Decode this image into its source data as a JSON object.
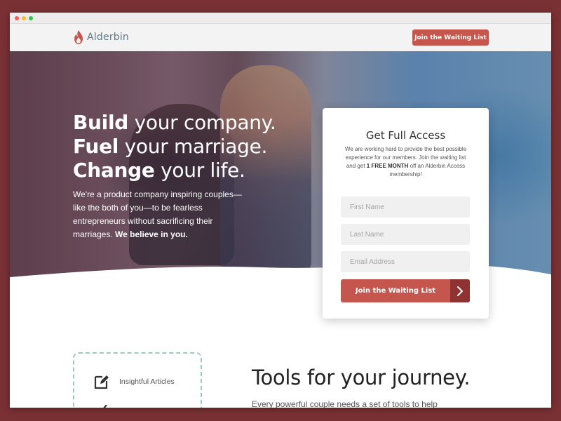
{
  "colors": {
    "brand": "#c4564d",
    "brand_dark": "#8e3331",
    "logo_text": "#5d7a84",
    "dash_border": "#9fc9bf",
    "backdrop": "#7a3134"
  },
  "nav": {
    "logo_text": "Alderbin",
    "cta_label": "Join the Waiting List"
  },
  "hero": {
    "lines": [
      {
        "bold": "Build",
        "rest": " your company."
      },
      {
        "bold": "Fuel",
        "rest": " your marriage."
      },
      {
        "bold": "Change",
        "rest": " your life."
      }
    ],
    "subtext": "We're a product company inspiring couples—like the both of you—to be fearless entrepreneurs without sacrificing their marriages.",
    "subtext_bold": "We believe in you."
  },
  "signup": {
    "title": "Get Full Access",
    "desc_before": "We are working hard to provide the best possible experience for our members. Join the waiting list and get ",
    "desc_bold": "1 FREE MONTH",
    "desc_after": " off an Alderbin Access membership!",
    "first_name_placeholder": "First Name",
    "last_name_placeholder": "Last Name",
    "email_placeholder": "Email Address",
    "cta_label": "Join the Waiting List",
    "cta_icon": "chevron-right-icon"
  },
  "features": {
    "items": [
      {
        "label": "Insightful Articles",
        "icon": "edit-icon"
      }
    ]
  },
  "tools": {
    "title": "Tools for your journey.",
    "subtitle": "Every powerful couple needs a set of tools to help"
  }
}
